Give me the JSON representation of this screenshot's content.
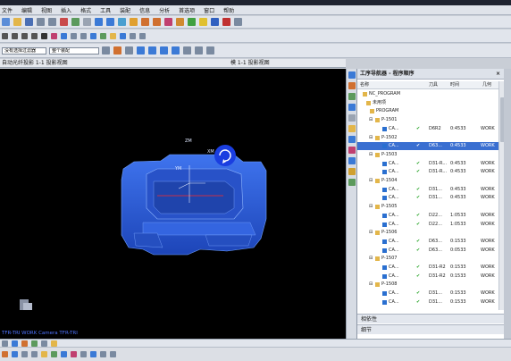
{
  "menubar": {
    "items": [
      "文件",
      "编辑",
      "视图",
      "插入",
      "格式",
      "工具",
      "装配",
      "信息",
      "分析",
      "首选项",
      "窗口",
      "帮助"
    ]
  },
  "toolbar": {
    "dropdown_filter": "没有选择过滤器",
    "dropdown_assembly": "整个装配"
  },
  "viewport": {
    "left_title": "自动光纤投影 1-1 投影视图",
    "right_title": "模 1-1 投影视图",
    "axis_zm": "ZM",
    "axis_xm": "XM",
    "axis_ym": "YM",
    "status_text": "TFR-TRI WORK Camera TFR-TRI"
  },
  "nav": {
    "title": "工序导航器 - 程序顺序",
    "col_name": "名称",
    "col_tool": "刀具",
    "col_time": "时间",
    "col_geo": "几何",
    "rows": [
      {
        "name": "NC_PROGRAM",
        "tool": "",
        "time": "",
        "geo": "",
        "indent": 0
      },
      {
        "name": "未用项",
        "tool": "",
        "time": "",
        "geo": "",
        "indent": 4
      },
      {
        "name": "PROGRAM",
        "tool": "",
        "time": "",
        "geo": "",
        "indent": 8
      },
      {
        "name": "P-1501",
        "tool": "",
        "time": "",
        "geo": "",
        "indent": 14
      },
      {
        "name": "CA...",
        "tool": "D6R2",
        "time": "0:4533",
        "geo": "WORK",
        "indent": 22
      },
      {
        "name": "P-1502",
        "tool": "",
        "time": "",
        "geo": "",
        "indent": 14
      },
      {
        "name": "CA...",
        "tool": "D63...",
        "time": "0:4533",
        "geo": "WORK",
        "indent": 22,
        "hi": true
      },
      {
        "name": "P-1503",
        "tool": "",
        "time": "",
        "geo": "",
        "indent": 14
      },
      {
        "name": "CA...",
        "tool": "D31-R...",
        "time": "0:4533",
        "geo": "WORK",
        "indent": 22
      },
      {
        "name": "CA...",
        "tool": "D31-R...",
        "time": "0:4533",
        "geo": "WORK",
        "indent": 22
      },
      {
        "name": "P-1504",
        "tool": "",
        "time": "",
        "geo": "",
        "indent": 14
      },
      {
        "name": "CA...",
        "tool": "D31...",
        "time": "0:4533",
        "geo": "WORK",
        "indent": 22
      },
      {
        "name": "CA...",
        "tool": "D31...",
        "time": "0:4533",
        "geo": "WORK",
        "indent": 22
      },
      {
        "name": "P-1505",
        "tool": "",
        "time": "",
        "geo": "",
        "indent": 14
      },
      {
        "name": "CA...",
        "tool": "D22...",
        "time": "1:0533",
        "geo": "WORK",
        "indent": 22
      },
      {
        "name": "CA...",
        "tool": "D22...",
        "time": "1:0533",
        "geo": "WORK",
        "indent": 22
      },
      {
        "name": "P-1506",
        "tool": "",
        "time": "",
        "geo": "",
        "indent": 14
      },
      {
        "name": "CA...",
        "tool": "D63...",
        "time": "0:1533",
        "geo": "WORK",
        "indent": 22
      },
      {
        "name": "CA...",
        "tool": "D63...",
        "time": "0:0533",
        "geo": "WORK",
        "indent": 22
      },
      {
        "name": "P-1507",
        "tool": "",
        "time": "",
        "geo": "",
        "indent": 14
      },
      {
        "name": "CA...",
        "tool": "D31-R2",
        "time": "0:1533",
        "geo": "WORK",
        "indent": 22
      },
      {
        "name": "CA...",
        "tool": "D31-R2",
        "time": "0:1533",
        "geo": "WORK",
        "indent": 22
      },
      {
        "name": "P-1508",
        "tool": "",
        "time": "",
        "geo": "",
        "indent": 14
      },
      {
        "name": "CA...",
        "tool": "D31...",
        "time": "0:1533",
        "geo": "WORK",
        "indent": 22
      },
      {
        "name": "CA...",
        "tool": "D31...",
        "time": "0:1533",
        "geo": "WORK",
        "indent": 22
      }
    ],
    "section_dependency": "相依性",
    "section_details": "细节"
  },
  "colors": {
    "accent": "#2a5fd0",
    "model": "#2f5fe0",
    "highlight": "#3a6fd1",
    "check": "#1ea01e"
  }
}
